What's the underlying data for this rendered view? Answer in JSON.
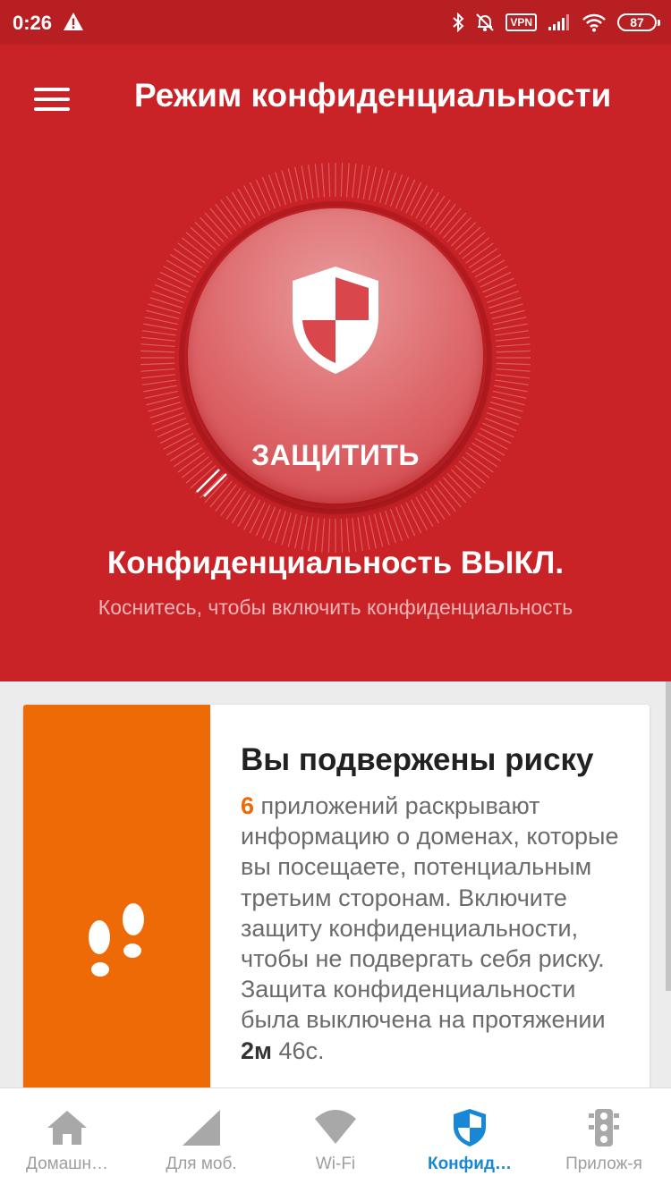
{
  "status_bar": {
    "time": "0:26",
    "vpn": "VPN",
    "battery": "87"
  },
  "header": {
    "title": "Режим конфиденциальности",
    "protect_label": "ЗАЩИТИТЬ",
    "status": "Конфиденциальность ВЫКЛ.",
    "hint": "Коснитесь, чтобы включить конфиденциальность"
  },
  "risk_card": {
    "title": "Вы подвержены риску",
    "apps_count": "6",
    "text_main": " приложений раскрывают информацию о доменах, которые вы посещаете, потенциальным третьим сторонам. Включите защиту конфиденциальности, чтобы не подвергать себя риску. Защита конфиденциальности была выключена на протяжении ",
    "duration_min": "2м",
    "duration_sec": " 46с."
  },
  "bottom_nav": {
    "items": [
      {
        "label": "Домашн…",
        "icon": "home-icon"
      },
      {
        "label": "Для моб.",
        "icon": "cellular-signal-icon"
      },
      {
        "label": "Wi-Fi",
        "icon": "wifi-icon"
      },
      {
        "label": "Конфид…",
        "icon": "shield-icon"
      },
      {
        "label": "Прилож-я",
        "icon": "traffic-light-icon"
      }
    ],
    "active_index": 3
  },
  "colors": {
    "header_red": "#c92328",
    "status_bar_red": "#b71f23",
    "risk_orange": "#ee6a07",
    "active_blue": "#1887d6"
  }
}
